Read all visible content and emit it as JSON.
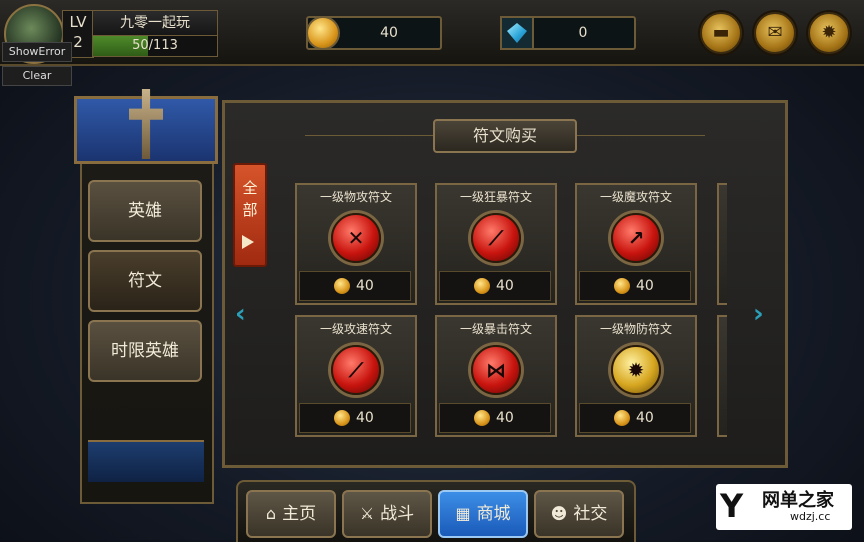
{
  "player": {
    "level_label": "LV",
    "level": "2",
    "name": "九零一起玩",
    "exp_text": "50/113",
    "exp_fraction": 0.44
  },
  "debug": {
    "show_error": "ShowError",
    "clear": "Clear"
  },
  "currency": {
    "gold": "40",
    "diamond": "0"
  },
  "top_buttons": {
    "chat_icon": "chat-bubble-icon",
    "mail_icon": "mail-icon",
    "settings_icon": "gear-icon"
  },
  "side_menu": {
    "items": [
      {
        "label": "英雄"
      },
      {
        "label": "符文"
      },
      {
        "label": "时限英雄"
      }
    ]
  },
  "shop": {
    "title": "符文购买",
    "filter_tab": "全部",
    "items": [
      {
        "name": "一级物攻符文",
        "price": "40",
        "orb_color": "#c8140e",
        "glyph": "✕"
      },
      {
        "name": "一级狂暴符文",
        "price": "40",
        "orb_color": "#c8140e",
        "glyph": "⟋"
      },
      {
        "name": "一级魔攻符文",
        "price": "40",
        "orb_color": "#c8140e",
        "glyph": "↗"
      },
      {
        "name": "一级攻速符文",
        "price": "40",
        "orb_color": "#c8140e",
        "glyph": "⟋"
      },
      {
        "name": "一级暴击符文",
        "price": "40",
        "orb_color": "#c8140e",
        "glyph": "⋈"
      },
      {
        "name": "一级物防符文",
        "price": "40",
        "orb_color": "#d6a620",
        "glyph": "✹"
      }
    ]
  },
  "bottom_nav": {
    "items": [
      {
        "label": "主页",
        "icon": "home-icon"
      },
      {
        "label": "战斗",
        "icon": "crossed-swords-icon"
      },
      {
        "label": "商城",
        "icon": "shop-cart-icon"
      },
      {
        "label": "社交",
        "icon": "people-icon"
      }
    ]
  },
  "watermark": {
    "logo_text": "网单之家",
    "domain": "wdzj.cc"
  }
}
